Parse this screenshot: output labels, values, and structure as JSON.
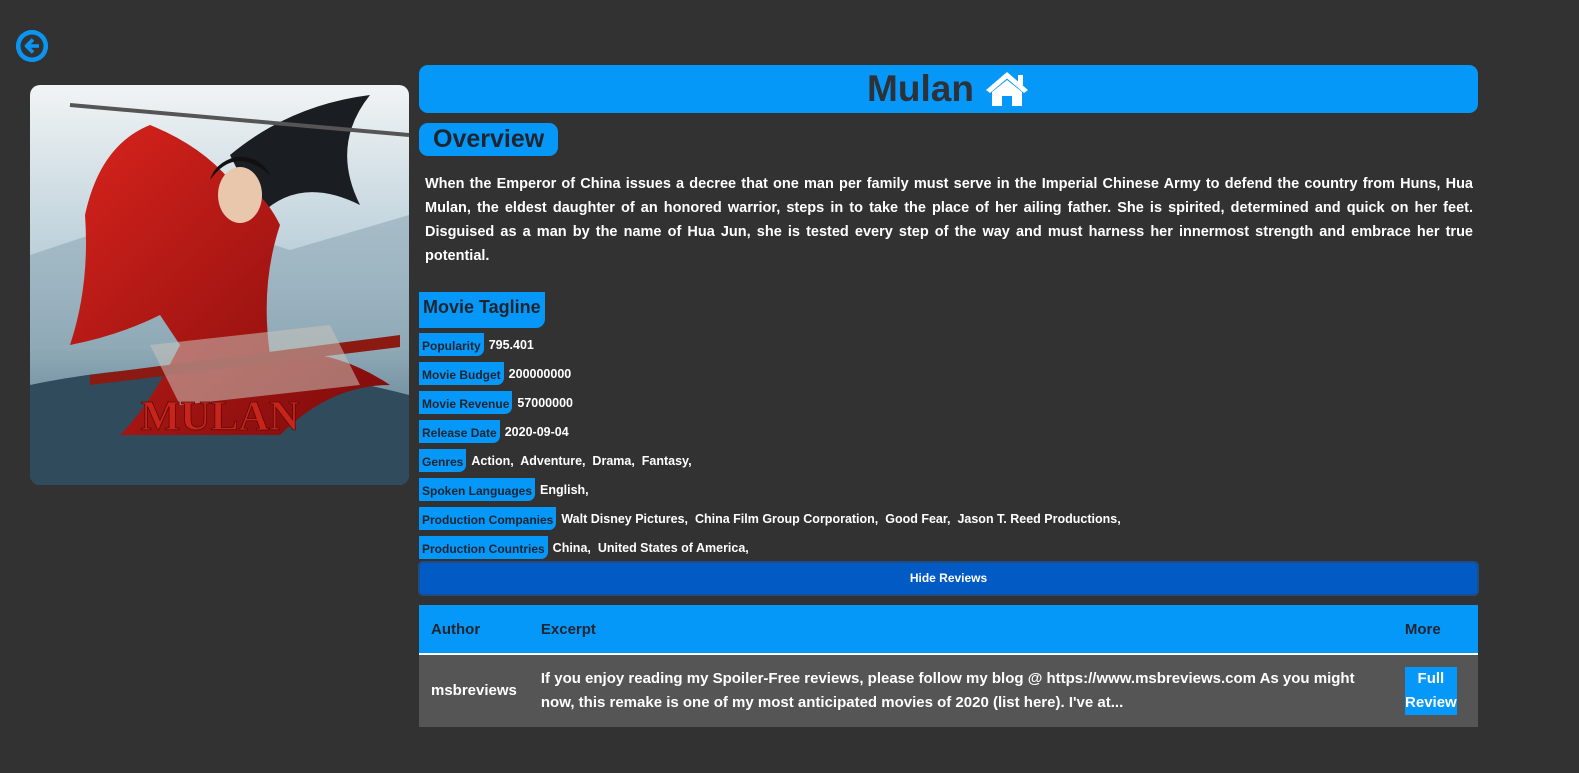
{
  "nav": {
    "back_icon": "arrow-left-circle-icon"
  },
  "colors": {
    "accent": "#0698f8",
    "background": "#323232",
    "button": "#025bc5",
    "row": "#555555"
  },
  "movie": {
    "title": "Mulan",
    "title_icon": "home-icon",
    "poster_text": "MULAN",
    "overview_heading": "Overview",
    "overview": "When the Emperor of China issues a decree that one man per family must serve in the Imperial Chinese Army to defend the country from Huns, Hua Mulan, the eldest daughter of an honored warrior, steps in to take the place of her ailing father. She is spirited, determined and quick on her feet. Disguised as a man by the name of Hua Jun, she is tested every step of the way and must harness her innermost strength and embrace her true potential.",
    "tagline_heading": "Movie Tagline"
  },
  "facts": [
    {
      "label": "Popularity",
      "value": "795.401"
    },
    {
      "label": "Movie Budget",
      "value": "200000000"
    },
    {
      "label": "Movie Revenue",
      "value": "57000000"
    },
    {
      "label": "Release Date",
      "value": "2020-09-04"
    },
    {
      "label": "Genres",
      "value": "Action,  Adventure,  Drama,  Fantasy,"
    },
    {
      "label": "Spoken Languages",
      "value": "English,"
    },
    {
      "label": "Production Companies",
      "value": "Walt Disney Pictures,  China Film Group Corporation,  Good Fear,  Jason T. Reed Productions,"
    },
    {
      "label": "Production Countries",
      "value": "China,  United States of America,"
    }
  ],
  "reviews": {
    "toggle_label": "Hide Reviews",
    "columns": {
      "author": "Author",
      "excerpt": "Excerpt",
      "more": "More"
    },
    "rows": [
      {
        "author": "msbreviews",
        "excerpt": "If you enjoy reading my Spoiler-Free reviews, please follow my blog @ https://www.msbreviews.com As you might now, this remake is one of my most anticipated movies of 2020 (list here). I've at...",
        "more_label": "Full Review"
      }
    ]
  }
}
